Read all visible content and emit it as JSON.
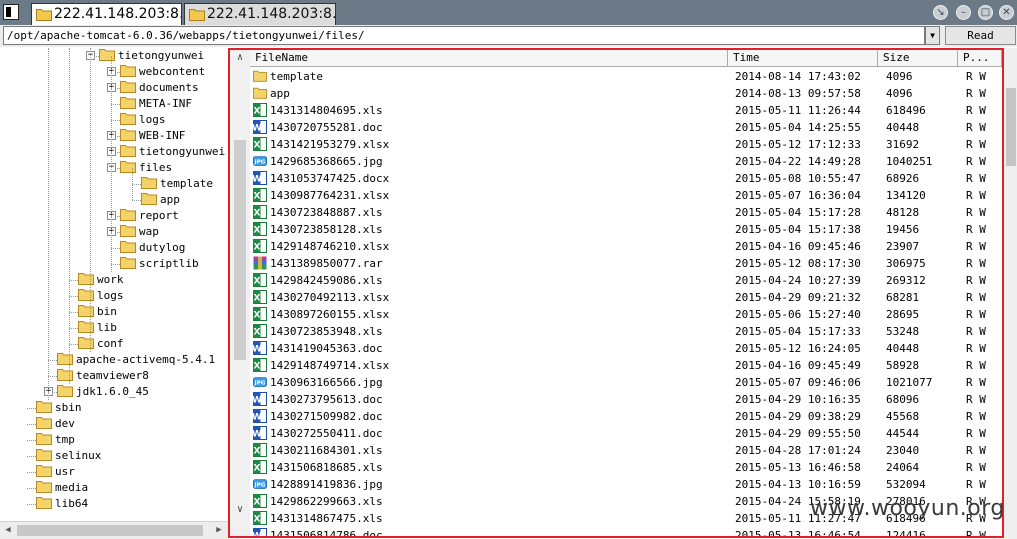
{
  "tabs": [
    {
      "label": "222.41.148.203:8…",
      "active": true
    },
    {
      "label": "222.41.148.203:8…",
      "active": false
    }
  ],
  "path": {
    "value": "/opt/apache-tomcat-6.0.36/webapps/tietongyunwei/files/",
    "read_label": "Read"
  },
  "tree": [
    {
      "label": "tietongyunwei",
      "level": 4,
      "expander": "minus"
    },
    {
      "label": "webcontent",
      "level": 5,
      "expander": "plus"
    },
    {
      "label": "documents",
      "level": 5,
      "expander": "plus"
    },
    {
      "label": "META-INF",
      "level": 5,
      "expander": ""
    },
    {
      "label": "logs",
      "level": 5,
      "expander": ""
    },
    {
      "label": "WEB-INF",
      "level": 5,
      "expander": "plus"
    },
    {
      "label": "tietongyunwei",
      "level": 5,
      "expander": "plus"
    },
    {
      "label": "files",
      "level": 5,
      "expander": "minus"
    },
    {
      "label": "template",
      "level": 6,
      "expander": ""
    },
    {
      "label": "app",
      "level": 6,
      "expander": ""
    },
    {
      "label": "report",
      "level": 5,
      "expander": "plus"
    },
    {
      "label": "wap",
      "level": 5,
      "expander": "plus"
    },
    {
      "label": "dutylog",
      "level": 5,
      "expander": ""
    },
    {
      "label": "scriptlib",
      "level": 5,
      "expander": ""
    },
    {
      "label": "work",
      "level": 3,
      "expander": ""
    },
    {
      "label": "logs",
      "level": 3,
      "expander": ""
    },
    {
      "label": "bin",
      "level": 3,
      "expander": ""
    },
    {
      "label": "lib",
      "level": 3,
      "expander": ""
    },
    {
      "label": "conf",
      "level": 3,
      "expander": ""
    },
    {
      "label": "apache-activemq-5.4.1",
      "level": 2,
      "expander": ""
    },
    {
      "label": "teamviewer8",
      "level": 2,
      "expander": ""
    },
    {
      "label": "jdk1.6.0_45",
      "level": 2,
      "expander": "plus"
    },
    {
      "label": "sbin",
      "level": 1,
      "expander": ""
    },
    {
      "label": "dev",
      "level": 1,
      "expander": ""
    },
    {
      "label": "tmp",
      "level": 1,
      "expander": ""
    },
    {
      "label": "selinux",
      "level": 1,
      "expander": ""
    },
    {
      "label": "usr",
      "level": 1,
      "expander": ""
    },
    {
      "label": "media",
      "level": 1,
      "expander": ""
    },
    {
      "label": "lib64",
      "level": 1,
      "expander": ""
    }
  ],
  "columns": [
    "FileName",
    "Time",
    "Size",
    "P..."
  ],
  "files": [
    {
      "name": "template",
      "type": "folder",
      "time": "2014-08-14 17:43:02",
      "size": "4096",
      "perm": "R W"
    },
    {
      "name": "app",
      "type": "folder",
      "time": "2014-08-13 09:57:58",
      "size": "4096",
      "perm": "R W"
    },
    {
      "name": "1431314804695.xls",
      "type": "xls",
      "time": "2015-05-11 11:26:44",
      "size": "618496",
      "perm": "R W"
    },
    {
      "name": "1430720755281.doc",
      "type": "doc",
      "time": "2015-05-04 14:25:55",
      "size": "40448",
      "perm": "R W"
    },
    {
      "name": "1431421953279.xlsx",
      "type": "xls",
      "time": "2015-05-12 17:12:33",
      "size": "31692",
      "perm": "R W"
    },
    {
      "name": "1429685368665.jpg",
      "type": "jpg",
      "time": "2015-04-22 14:49:28",
      "size": "1040251",
      "perm": "R W"
    },
    {
      "name": "1431053747425.docx",
      "type": "doc",
      "time": "2015-05-08 10:55:47",
      "size": "68926",
      "perm": "R W"
    },
    {
      "name": "1430987764231.xlsx",
      "type": "xls",
      "time": "2015-05-07 16:36:04",
      "size": "134120",
      "perm": "R W"
    },
    {
      "name": "1430723848887.xls",
      "type": "xls",
      "time": "2015-05-04 15:17:28",
      "size": "48128",
      "perm": "R W"
    },
    {
      "name": "1430723858128.xls",
      "type": "xls",
      "time": "2015-05-04 15:17:38",
      "size": "19456",
      "perm": "R W"
    },
    {
      "name": "1429148746210.xlsx",
      "type": "xls",
      "time": "2015-04-16 09:45:46",
      "size": "23907",
      "perm": "R W"
    },
    {
      "name": "1431389850077.rar",
      "type": "rar",
      "time": "2015-05-12 08:17:30",
      "size": "306975",
      "perm": "R W"
    },
    {
      "name": "1429842459086.xls",
      "type": "xls",
      "time": "2015-04-24 10:27:39",
      "size": "269312",
      "perm": "R W"
    },
    {
      "name": "1430270492113.xlsx",
      "type": "xls",
      "time": "2015-04-29 09:21:32",
      "size": "68281",
      "perm": "R W"
    },
    {
      "name": "1430897260155.xlsx",
      "type": "xls",
      "time": "2015-05-06 15:27:40",
      "size": "28695",
      "perm": "R W"
    },
    {
      "name": "1430723853948.xls",
      "type": "xls",
      "time": "2015-05-04 15:17:33",
      "size": "53248",
      "perm": "R W"
    },
    {
      "name": "1431419045363.doc",
      "type": "doc",
      "time": "2015-05-12 16:24:05",
      "size": "40448",
      "perm": "R W"
    },
    {
      "name": "1429148749714.xlsx",
      "type": "xls",
      "time": "2015-04-16 09:45:49",
      "size": "58928",
      "perm": "R W"
    },
    {
      "name": "1430963166566.jpg",
      "type": "jpg",
      "time": "2015-05-07 09:46:06",
      "size": "1021077",
      "perm": "R W"
    },
    {
      "name": "1430273795613.doc",
      "type": "doc",
      "time": "2015-04-29 10:16:35",
      "size": "68096",
      "perm": "R W"
    },
    {
      "name": "1430271509982.doc",
      "type": "doc",
      "time": "2015-04-29 09:38:29",
      "size": "45568",
      "perm": "R W"
    },
    {
      "name": "1430272550411.doc",
      "type": "doc",
      "time": "2015-04-29 09:55:50",
      "size": "44544",
      "perm": "R W"
    },
    {
      "name": "1430211684301.xls",
      "type": "xls",
      "time": "2015-04-28 17:01:24",
      "size": "23040",
      "perm": "R W"
    },
    {
      "name": "1431506818685.xls",
      "type": "xls",
      "time": "2015-05-13 16:46:58",
      "size": "24064",
      "perm": "R W"
    },
    {
      "name": "1428891419836.jpg",
      "type": "jpg",
      "time": "2015-04-13 10:16:59",
      "size": "532094",
      "perm": "R W"
    },
    {
      "name": "1429862299663.xls",
      "type": "xls",
      "time": "2015-04-24 15:58:19",
      "size": "278016",
      "perm": "R W"
    },
    {
      "name": "1431314867475.xls",
      "type": "xls",
      "time": "2015-05-11 11:27:47",
      "size": "618496",
      "perm": "R W"
    },
    {
      "name": "1431506814786.doc",
      "type": "doc",
      "time": "2015-05-13 16:46:54",
      "size": "124416",
      "perm": "R W"
    }
  ],
  "watermark": "www.wooyun.org",
  "colors": {
    "highlight_border": "#e0202a",
    "titlebar": "#6c7a88"
  }
}
